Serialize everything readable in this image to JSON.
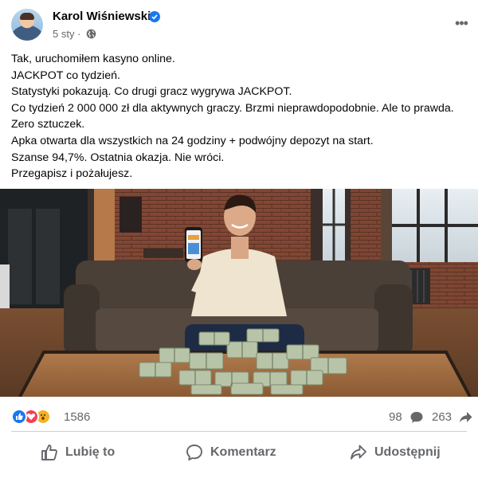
{
  "post": {
    "author": "Karol Wiśniewski",
    "time": "5 sty",
    "separator": "·",
    "more_label": "•••",
    "lines": [
      "Tak, uruchomiłem kasyno online.",
      "JACKPOT co tydzień.",
      "Statystyki pokazują. Co drugi gracz wygrywa JACKPOT.",
      "Co tydzień 2 000 000 zł dla aktywnych graczy. Brzmi nieprawdopodobnie. Ale to prawda.",
      "Zero sztuczek.",
      "Apka otwarta dla wszystkich na 24 godziny + podwójny depozyt na start.",
      "Szanse 94,7%. Ostatnia okazja. Nie wróci.",
      "Przegapisz i pożałujesz."
    ]
  },
  "stats": {
    "reaction_count": "1586",
    "comment_count": "98",
    "share_count": "263",
    "reaction_types": [
      "like-icon",
      "love-icon",
      "wow-icon"
    ]
  },
  "actions": {
    "like_label": "Lubię to",
    "comment_label": "Komentarz",
    "share_label": "Udostępnij"
  },
  "colors": {
    "brand_blue": "#1877f2",
    "love_red": "#f33e58",
    "wow_yellow": "#f7b125",
    "secondary_text": "#65676b"
  }
}
